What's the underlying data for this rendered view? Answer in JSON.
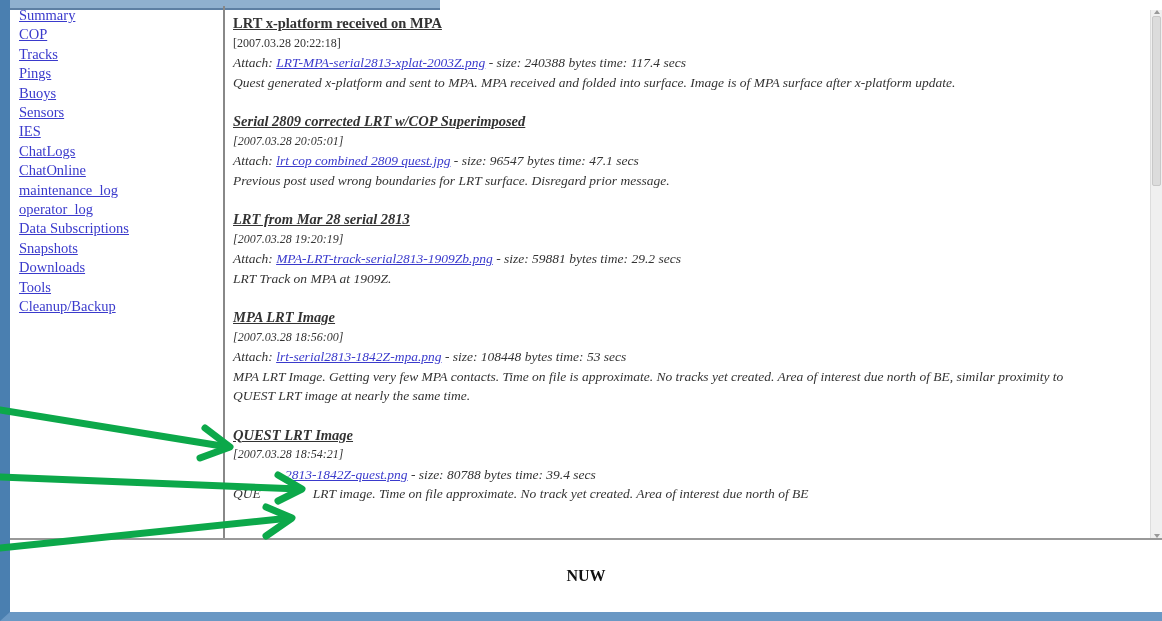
{
  "sidebar": {
    "items": [
      {
        "label": "Summary"
      },
      {
        "label": "COP"
      },
      {
        "label": "Tracks"
      },
      {
        "label": "Pings"
      },
      {
        "label": "Buoys"
      },
      {
        "label": "Sensors"
      },
      {
        "label": "IES"
      },
      {
        "label": "ChatLogs"
      },
      {
        "label": "ChatOnline"
      },
      {
        "label": "maintenance_log"
      },
      {
        "label": "operator_log"
      },
      {
        "label": "Data Subscriptions"
      },
      {
        "label": "Snapshots"
      },
      {
        "label": "Downloads"
      },
      {
        "label": "Tools"
      },
      {
        "label": "Cleanup/Backup"
      }
    ]
  },
  "posts": [
    {
      "title": "LRT x-platform received on MPA",
      "italic": false,
      "timestamp": "[2007.03.28 20:22:18]",
      "attach_label": "Attach:",
      "attachment": "LRT-MPA-serial2813-xplat-2003Z.png",
      "size": "- size: 240388 bytes time: 117.4 secs",
      "body": "Quest generated x-platform and sent to MPA. MPA received and folded into surface. Image is of MPA surface after x-platform update."
    },
    {
      "title": "Serial 2809 corrected LRT w/COP Superimposed",
      "italic": true,
      "timestamp": "[2007.03.28 20:05:01]",
      "attach_label": "Attach:",
      "attachment": "lrt cop combined 2809 quest.jpg",
      "size": "- size: 96547 bytes time: 47.1 secs",
      "body": "Previous post used wrong boundaries for LRT surface. Disregard prior message."
    },
    {
      "title": "LRT from Mar 28 serial 2813",
      "italic": true,
      "timestamp": "[2007.03.28 19:20:19]",
      "attach_label": "Attach:",
      "attachment": "MPA-LRT-track-serial2813-1909Zb.png",
      "size": "- size: 59881 bytes time: 29.2 secs",
      "body": "LRT Track on MPA at 1909Z."
    },
    {
      "title": "MPA LRT Image",
      "italic": true,
      "timestamp": "[2007.03.28 18:56:00]",
      "attach_label": "Attach:",
      "attachment": "lrt-serial2813-1842Z-mpa.png",
      "size": "- size: 108448 bytes time: 53 secs",
      "body": "MPA LRT Image. Getting very few MPA contacts. Time on file is approximate. No tracks yet created. Area of interest due north of BE, similar proximity to QUEST LRT image at nearly the same time."
    },
    {
      "title": "QUEST LRT Image",
      "italic": true,
      "timestamp": "[2007.03.28 18:54:21]",
      "attachment": "2813-1842Z-quest.png",
      "size": "- size: 80788 bytes time: 39.4 secs",
      "body_start": "QUE",
      "body": "LRT image. Time on file approximate. No track yet created. Area of interest due north of BE"
    }
  ],
  "footer": {
    "text": "NUW"
  }
}
